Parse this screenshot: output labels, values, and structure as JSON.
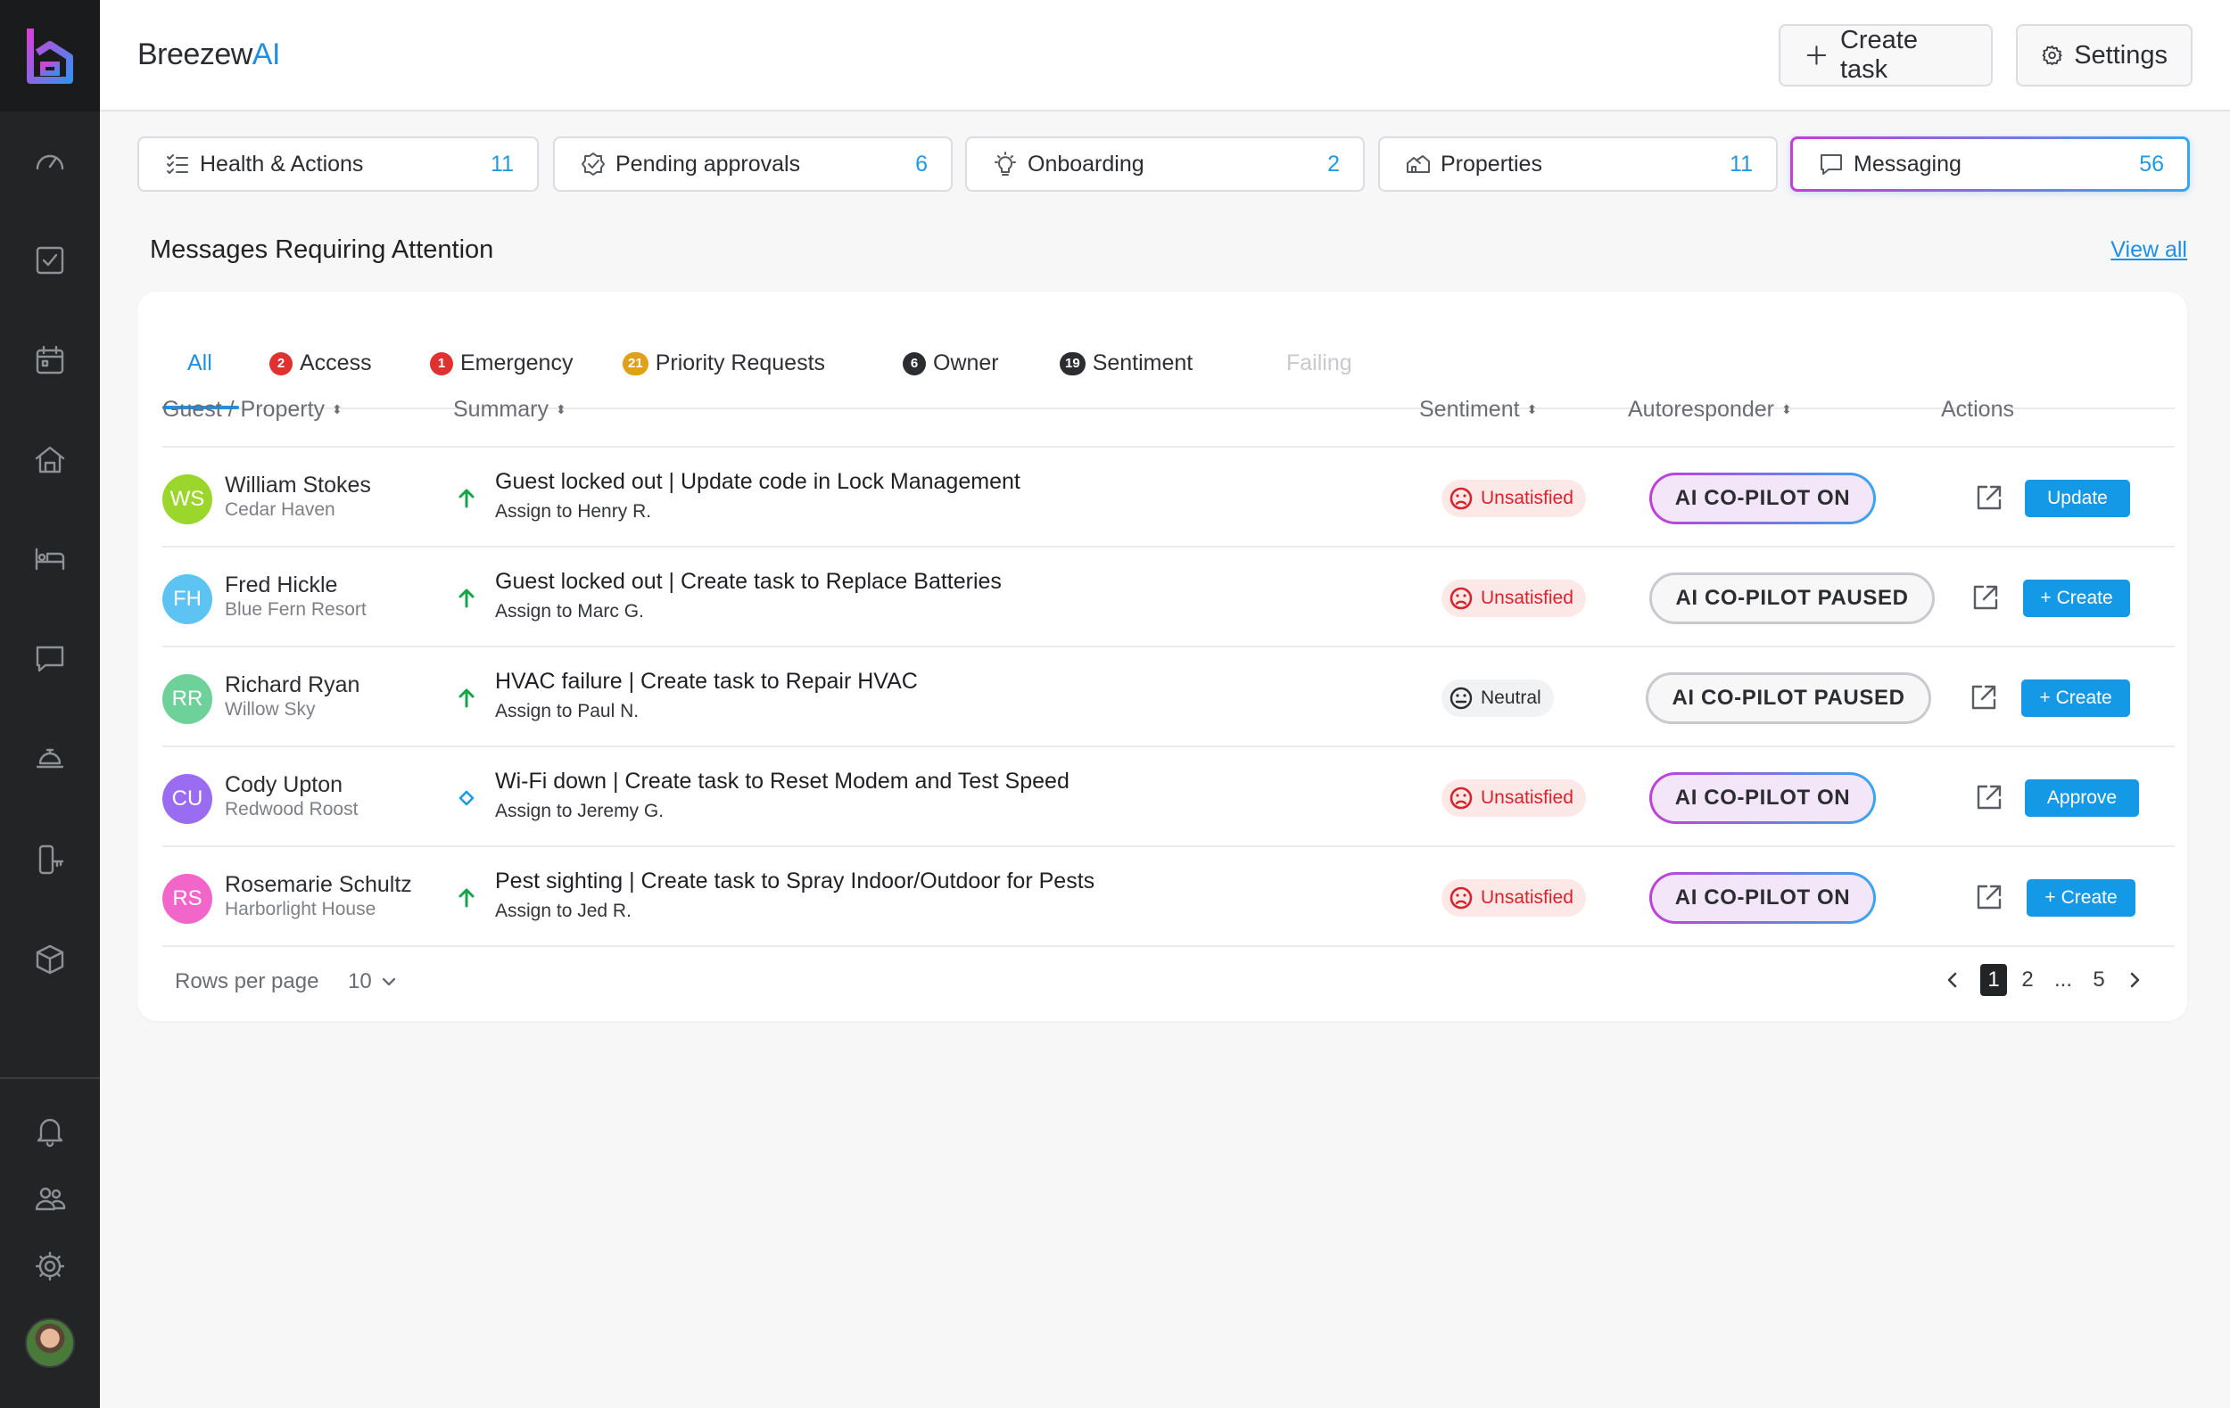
{
  "app": {
    "brand_main": "Breezew",
    "brand_accent": "AI"
  },
  "header": {
    "create_task_label": "Create task",
    "settings_label": "Settings"
  },
  "sidebar": {
    "icons": [
      "dashboard-icon",
      "tasks-icon",
      "calendar-icon",
      "home-icon",
      "bed-icon",
      "messages-icon",
      "service-bell-icon",
      "lock-device-icon",
      "package-icon",
      "bell-icon",
      "team-icon",
      "settings-icon"
    ]
  },
  "stat_tabs": [
    {
      "label": "Health & Actions",
      "count": "11"
    },
    {
      "label": "Pending approvals",
      "count": "6"
    },
    {
      "label": "Onboarding",
      "count": "2"
    },
    {
      "label": "Properties",
      "count": "11"
    },
    {
      "label": "Messaging",
      "count": "56"
    }
  ],
  "section": {
    "title": "Messages Requiring Attention",
    "view_all": "View all"
  },
  "filters": [
    {
      "label": "All",
      "badge": ""
    },
    {
      "label": "Access",
      "badge": "2"
    },
    {
      "label": "Emergency",
      "badge": "1"
    },
    {
      "label": "Priority Requests",
      "badge": "21"
    },
    {
      "label": "Owner",
      "badge": "6"
    },
    {
      "label": "Sentiment",
      "badge": "19"
    },
    {
      "label": "Failing",
      "badge": ""
    }
  ],
  "columns": {
    "guest": "Guest / Property",
    "summary": "Summary",
    "sentiment": "Sentiment",
    "autoresponder": "Autoresponder",
    "actions": "Actions"
  },
  "rows": [
    {
      "initials": "WS",
      "name": "William Stokes",
      "property": "Cedar Haven",
      "summary_a": "Guest locked out | ",
      "summary_b": "Update code",
      "summary_c": " in ",
      "summary_d": "Lock Management",
      "assign": "Assign to Henry R.",
      "sentiment": "Unsatisfied",
      "autoresponder": "AI CO-PILOT ON",
      "action": "Update"
    },
    {
      "initials": "FH",
      "name": "Fred Hickle",
      "property": "Blue Fern Resort",
      "summary_a": "Guest locked out | ",
      "summary_b": "Create task",
      "summary_c": " to ",
      "summary_d": "Replace Batteries",
      "assign": "Assign to Marc G.",
      "sentiment": "Unsatisfied",
      "autoresponder": "AI CO-PILOT PAUSED",
      "action": "Create"
    },
    {
      "initials": "RR",
      "name": "Richard Ryan",
      "property": "Willow Sky",
      "summary_a": "HVAC failure | ",
      "summary_b": "Create task",
      "summary_c": " to ",
      "summary_d": "Repair HVAC",
      "assign": "Assign to Paul N.",
      "sentiment": "Neutral",
      "autoresponder": "AI CO-PILOT PAUSED",
      "action": "Create"
    },
    {
      "initials": "CU",
      "name": "Cody Upton",
      "property": "Redwood Roost",
      "summary_a": "Wi-Fi down | ",
      "summary_b": "Create task",
      "summary_c": " to ",
      "summary_d": "Reset Modem and Test Speed",
      "assign": "Assign to Jeremy G.",
      "sentiment": "Unsatisfied",
      "autoresponder": "AI CO-PILOT ON",
      "action": "Approve"
    },
    {
      "initials": "RS",
      "name": "Rosemarie Schultz",
      "property": "Harborlight House",
      "summary_a": "Pest sighting | ",
      "summary_b": "Create task",
      "summary_c": " to ",
      "summary_d": "Spray Indoor/Outdoor for Pests",
      "assign": "Assign to Jed R.",
      "sentiment": "Unsatisfied",
      "autoresponder": "AI CO-PILOT ON",
      "action": "Create"
    }
  ],
  "pagination": {
    "rows_label": "Rows per page",
    "rows_value": "10",
    "pages": [
      "1",
      "2",
      "...",
      "5"
    ]
  },
  "colors": {
    "accent": "#1e8fe3",
    "unsatisfied": "#d8232a",
    "action_button": "#1499e6"
  }
}
